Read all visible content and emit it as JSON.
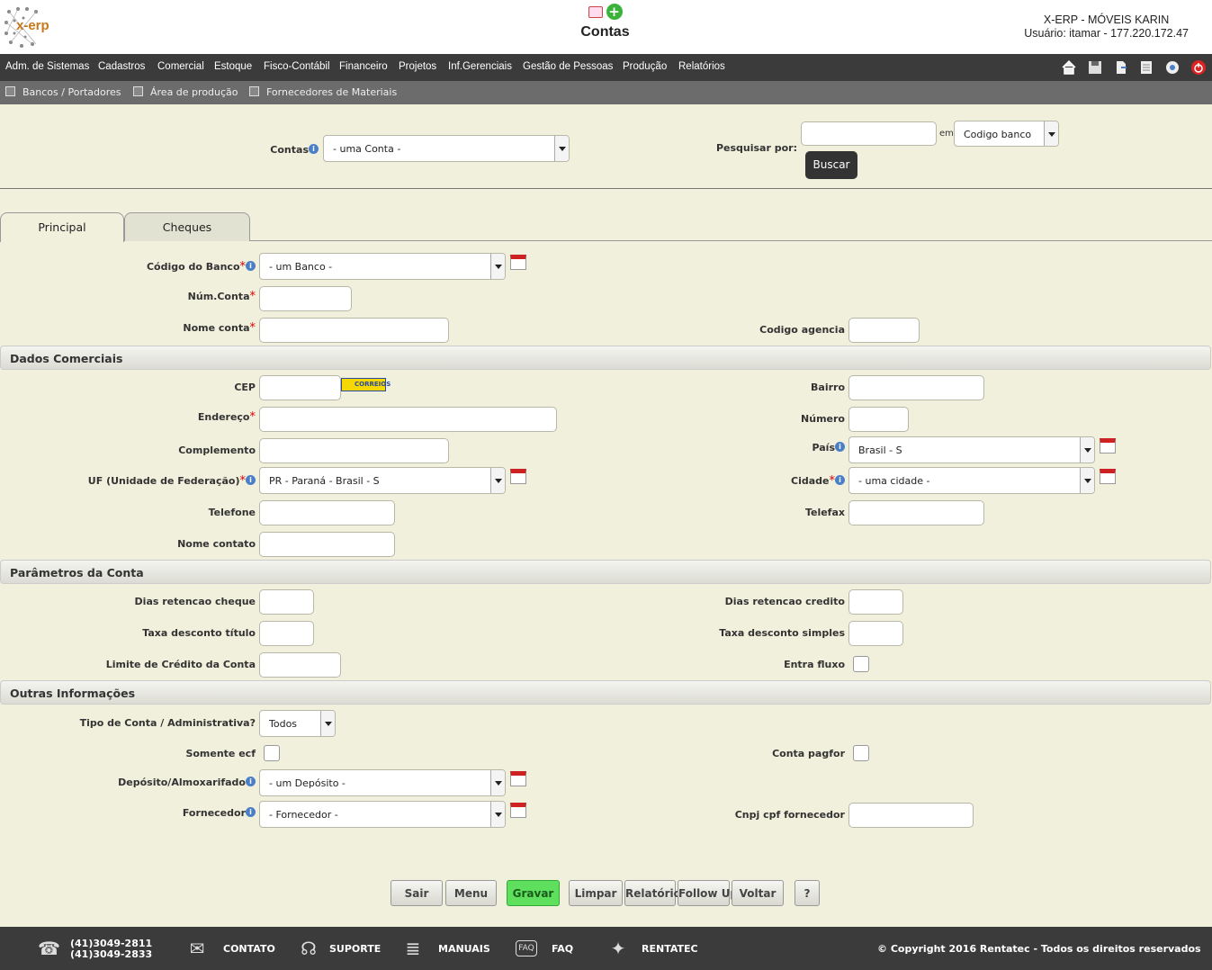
{
  "header": {
    "logo_text": "x-erp",
    "page_title": "Contas",
    "company": "X-ERP - MÓVEIS KARIN",
    "user": "Usuário: itamar - 177.220.172.47"
  },
  "menu": [
    "Adm. de Sistemas",
    "Cadastros",
    "Comercial",
    "Estoque",
    "Fisco-Contábil",
    "Financeiro",
    "Projetos",
    "Inf.Gerenciais",
    "Gestão de Pessoas",
    "Produção",
    "Relatórios"
  ],
  "quickbar": [
    "Bancos / Portadores",
    "Área de produção",
    "Fornecedores de Materiais"
  ],
  "search": {
    "contas_label": "Contas",
    "contas_value": "- uma Conta -",
    "pesquisar_label": "Pesquisar por:",
    "em_label": "em",
    "em_value": "Codigo banco",
    "buscar": "Buscar"
  },
  "tabs": [
    "Principal",
    "Cheques"
  ],
  "fields": {
    "codigo_banco": "Código do Banco",
    "codigo_banco_value": "- um Banco -",
    "num_conta": "Núm.Conta",
    "nome_conta": "Nome conta",
    "codigo_agencia": "Codigo agencia"
  },
  "sections": {
    "dados": "Dados Comerciais",
    "parametros": "Parâmetros da Conta",
    "outras": "Outras Informações"
  },
  "dados": {
    "cep": "CEP",
    "correios": "CORREIOS",
    "bairro": "Bairro",
    "endereco": "Endereço",
    "numero": "Número",
    "complemento": "Complemento",
    "pais": "País",
    "pais_value": "Brasil - S",
    "uf": "UF (Unidade de Federação)",
    "uf_value": "PR - Paraná - Brasil - S",
    "cidade": "Cidade",
    "cidade_value": "- uma cidade -",
    "telefone": "Telefone",
    "telefax": "Telefax",
    "nome_contato": "Nome contato"
  },
  "parametros": {
    "dias_cheque": "Dias retencao cheque",
    "dias_credito": "Dias retencao credito",
    "taxa_titulo": "Taxa desconto título",
    "taxa_simples": "Taxa desconto simples",
    "limite": "Limite de Crédito da Conta",
    "entra_fluxo": "Entra fluxo"
  },
  "outras": {
    "tipo_conta": "Tipo de Conta / Administrativa?",
    "tipo_conta_value": "Todos",
    "somente_ecf": "Somente ecf",
    "conta_pagfor": "Conta pagfor",
    "deposito": "Depósito/Almoxarifado",
    "deposito_value": "- um Depósito -",
    "fornecedor": "Fornecedor",
    "fornecedor_value": "- Fornecedor -",
    "cnpj": "Cnpj cpf fornecedor"
  },
  "buttons": [
    "Sair",
    "Menu",
    "Gravar",
    "Limpar",
    "Relatório",
    "Follow Up",
    "Voltar",
    "?"
  ],
  "footer": {
    "phone1": "(41)3049-2811",
    "phone2": "(41)3049-2833",
    "contato": "CONTATO",
    "suporte": "SUPORTE",
    "manuais": "MANUAIS",
    "faq": "FAQ",
    "rentatec": "RENTATEC",
    "copyright": "© Copyright 2016 Rentatec - Todos os direitos reservados"
  },
  "colors": {
    "menubar": "#3b3b3b",
    "background": "#f1f0dd",
    "gravar": "#5ee05e",
    "buscar": "#333333"
  }
}
